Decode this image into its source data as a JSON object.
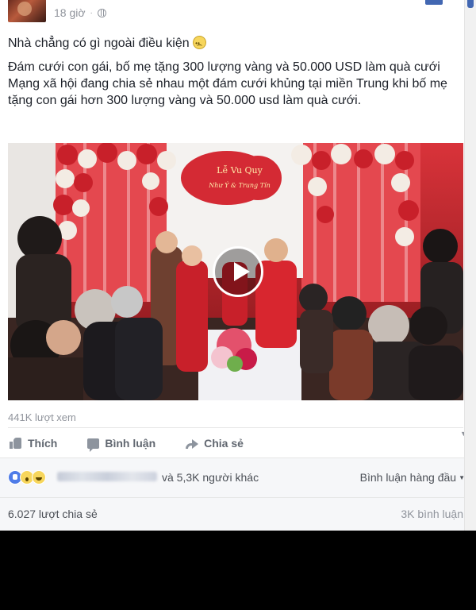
{
  "post": {
    "timestamp": "18 giờ",
    "separator": "·",
    "privacy_icon": "globe-icon",
    "status_line": "Nhà chẳng có gì ngoài điều kiện",
    "headline": "Đám cưới con gái, bố mẹ tặng 300 lượng vàng và 50.000 USD làm quà cưới",
    "body": "Mạng xã hội đang chia sẻ nhau một đám cưới khủng tại miền Trung khi bố mẹ tặng con gái hơn 300 lượng vàng và 50.000 usd làm quà cưới.",
    "video": {
      "banner_line1": "Lễ Vu Quy",
      "banner_line2": "Như Ý  &  Trung Tín"
    },
    "views": "441K lượt xem"
  },
  "actions": {
    "like": "Thích",
    "comment": "Bình luận",
    "share": "Chia sẻ"
  },
  "reactions": {
    "icons": [
      "like-icon",
      "wow-icon",
      "haha-icon"
    ],
    "others": "và 5,3K người khác",
    "sort": "Bình luận hàng đầu"
  },
  "stats": {
    "shares": "6.027 lượt chia sẻ",
    "comments": "3K bình luận"
  },
  "colors": {
    "facebook_blue": "#4267b2",
    "meta_gray": "#90949c",
    "wedding_red": "#c8202a"
  }
}
